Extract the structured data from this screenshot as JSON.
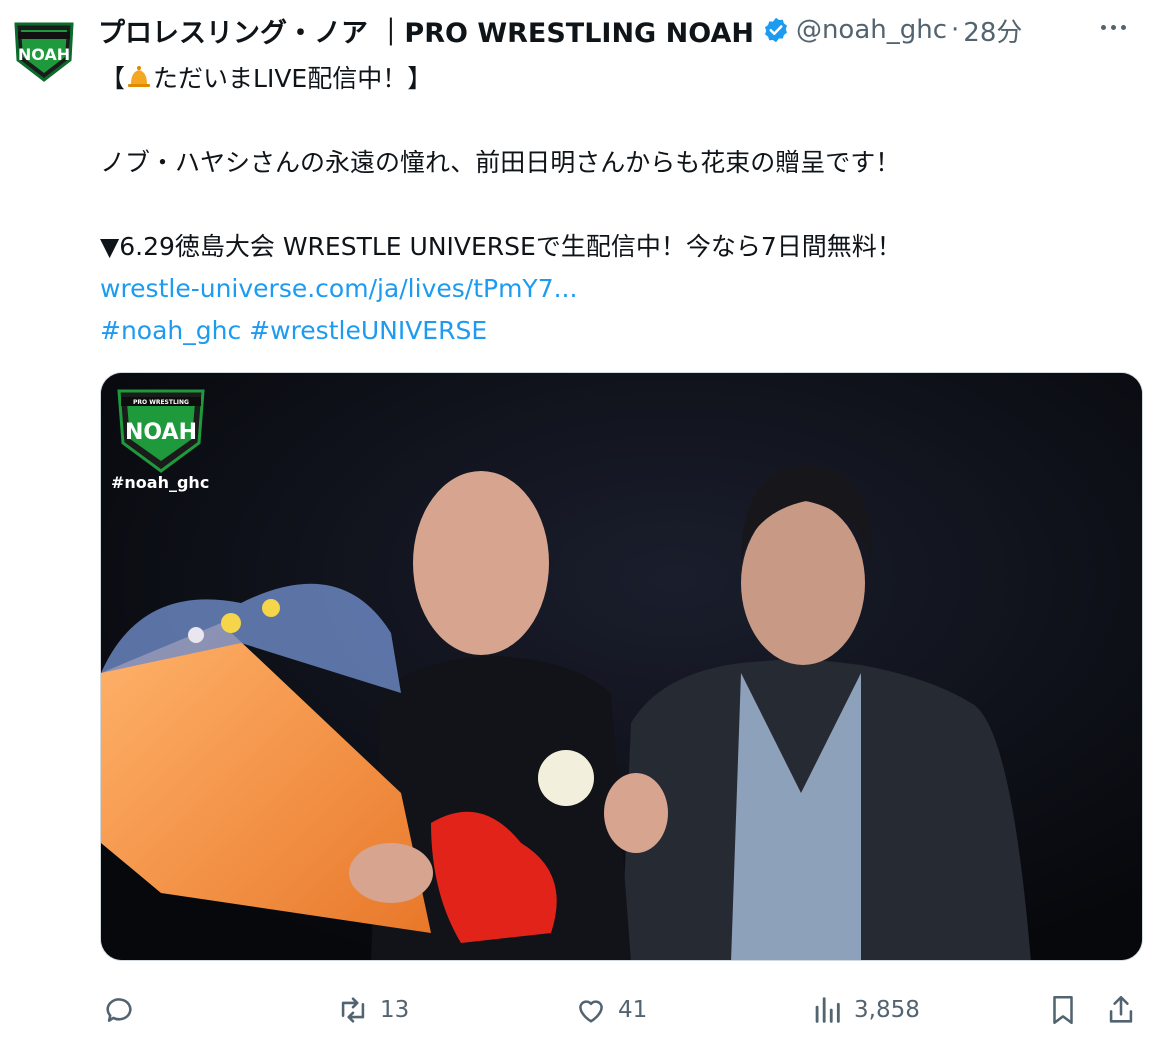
{
  "tweet": {
    "avatar_icon": "noah-shield-logo",
    "display_name": "プロレスリング・ノア ｜PRO WRESTLING NOAH",
    "verified_icon": "verified-badge-icon",
    "handle": "@noah_ghc",
    "separator": "·",
    "timestamp": "28分",
    "more_icon": "more-options-icon",
    "lines": {
      "live_pre": "【",
      "live_text": "ただいまLIVE配信中！】",
      "message": "ノブ・ハヤシさんの永遠の憧れ、前田日明さんからも花束の贈呈です！",
      "event": "▼6.29徳島大会 WRESTLE UNIVERSEで生配信中！今なら7日間無料！",
      "link": "wrestle-universe.com/ja/lives/tPmY7...",
      "hashtag_1": "#noah_ghc",
      "hashtag_2": "#wrestleUNIVERSE"
    },
    "media": {
      "logo_top": "PRO WRESTLING",
      "logo_main": "NOAH",
      "overlay_tag": "#noah_ghc"
    },
    "actions": {
      "reply_count": "",
      "retweet_count": "13",
      "like_count": "41",
      "view_count": "3,858"
    }
  },
  "colors": {
    "accent": "#1d9bf0",
    "secondary_text": "#536471",
    "brand_green": "#1e9a3c"
  }
}
